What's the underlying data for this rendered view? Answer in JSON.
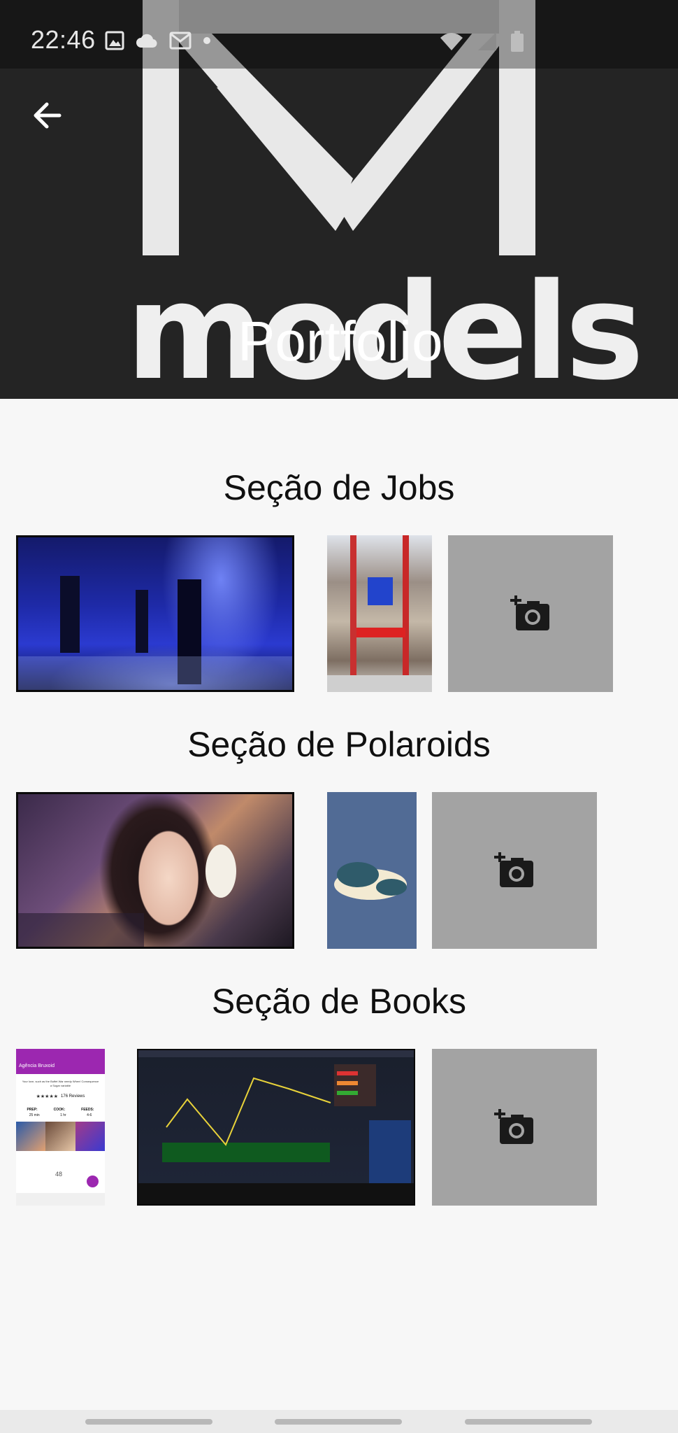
{
  "status_bar": {
    "time": "22:46",
    "icons_left": [
      "image-icon",
      "cloud-icon",
      "mail-icon",
      "dot-icon"
    ],
    "icons_right": [
      "wifi-icon",
      "signal-icon",
      "battery-icon"
    ]
  },
  "header": {
    "title": "Portfolio",
    "logo_text": "models",
    "back_icon": "arrow-back-icon"
  },
  "sections": [
    {
      "title": "Seção de Jobs",
      "items": [
        "photo",
        "photo",
        "add-photo"
      ]
    },
    {
      "title": "Seção de Polaroids",
      "items": [
        "photo",
        "photo",
        "add-photo"
      ]
    },
    {
      "title": "Seção de Books",
      "items": [
        "photo",
        "photo",
        "add-photo"
      ]
    }
  ],
  "books_app_preview": {
    "app_title": "Agência Bruxoid",
    "text": "Your love, such as the Buffet War needy When! Consequence a Sugar variable",
    "reviews": "176 Reviews",
    "prep_label": "PREP:",
    "prep_value": "25 min",
    "cook_label": "COOK:",
    "cook_value": "1 hr",
    "feeds_label": "FEEDS:",
    "feeds_value": "4-6",
    "count": "48"
  },
  "colors": {
    "header_bg": "#242424",
    "page_bg": "#f7f7f7",
    "add_photo_bg": "#a3a3a3",
    "accent_purple": "#9c27b0"
  }
}
